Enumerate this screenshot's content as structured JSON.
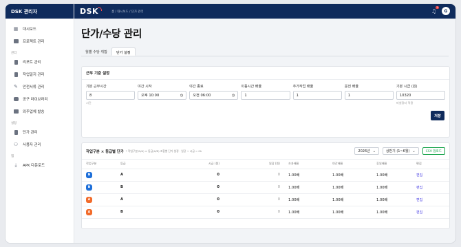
{
  "sidebar": {
    "brand": "DSK 관리자",
    "items_top": [
      {
        "label": "대시보드",
        "icon": "grid-icon"
      },
      {
        "label": "프로젝트 관리",
        "icon": "folder-icon"
      }
    ],
    "section_manage": "관리",
    "items_manage": [
      {
        "label": "리포트 관리",
        "icon": "document-icon"
      },
      {
        "label": "작업일지 관리",
        "icon": "document-icon"
      },
      {
        "label": "안전서류 관리",
        "icon": "pencil-icon"
      },
      {
        "label": "공구 라이브러리",
        "icon": "chat-icon"
      },
      {
        "label": "외주업체 발송",
        "icon": "mail-icon"
      }
    ],
    "section_settings": "설정",
    "items_settings": [
      {
        "label": "단가 관리",
        "icon": "document-icon"
      },
      {
        "label": "사용자 관리",
        "icon": "users-icon"
      }
    ],
    "section_misc": "앱",
    "items_misc": [
      {
        "label": "APK 다운로드",
        "icon": "download-icon"
      }
    ]
  },
  "topbar": {
    "logo": "DSK",
    "breadcrumb": "홈 / 대시보드 / 단가 관리",
    "notification_count": "1",
    "avatar_initial": "G"
  },
  "page": {
    "title": "단가/수당 관리",
    "tabs": [
      "월별 수당 취합",
      "단가 설정"
    ]
  },
  "criteria": {
    "title": "근무 기준 설정",
    "fields": [
      {
        "label": "기본 근무시간",
        "value": "8",
        "hint": "시간"
      },
      {
        "label": "야간 시작",
        "value": "오후 10:00",
        "hint": ""
      },
      {
        "label": "야간 종료",
        "value": "오전 06:00",
        "hint": ""
      },
      {
        "label": "이동시간 배율",
        "value": "1",
        "hint": ""
      },
      {
        "label": "추가작업 배율",
        "value": "1",
        "hint": ""
      },
      {
        "label": "운전 배율",
        "value": "1",
        "hint": ""
      },
      {
        "label": "기본 시급 (원)",
        "value": "10320",
        "hint": "미설정자 적용"
      }
    ],
    "save_label": "저장"
  },
  "rates": {
    "title": "작업구분 × 등급별 단가",
    "subtitle": "* 작업구분(N/A) × 등급(A/B) 조합별 단가 설정 · 일당 ÷ 시급 = 0h",
    "year": "2026년",
    "half": "상반기 (1~6월)",
    "csv_label": "CSV 업로드",
    "headers": [
      "작업구분",
      "등급",
      "시급 (원)",
      "일당 (원)",
      "초과배율",
      "야간배율",
      "휴일배율",
      "편집"
    ],
    "rows": [
      {
        "type": "N",
        "grade": "A",
        "hourly": "0",
        "daily": "0",
        "overtime": "1.00배",
        "night": "1.00배",
        "holiday": "1.00배",
        "edit": "편집"
      },
      {
        "type": "N",
        "grade": "B",
        "hourly": "0",
        "daily": "0",
        "overtime": "1.00배",
        "night": "1.00배",
        "holiday": "1.00배",
        "edit": "편집"
      },
      {
        "type": "A",
        "grade": "A",
        "hourly": "0",
        "daily": "0",
        "overtime": "1.00배",
        "night": "1.00배",
        "holiday": "1.00배",
        "edit": "편집"
      },
      {
        "type": "A",
        "grade": "B",
        "hourly": "0",
        "daily": "0",
        "overtime": "1.00배",
        "night": "1.00배",
        "holiday": "1.00배",
        "edit": "편집"
      }
    ]
  },
  "colors": {
    "navy": "#0f2b5c",
    "badge_N": "#1e6fd9",
    "badge_A": "#f26b2a",
    "csv_green": "#16a34a",
    "edit_link": "#4f46e5"
  }
}
